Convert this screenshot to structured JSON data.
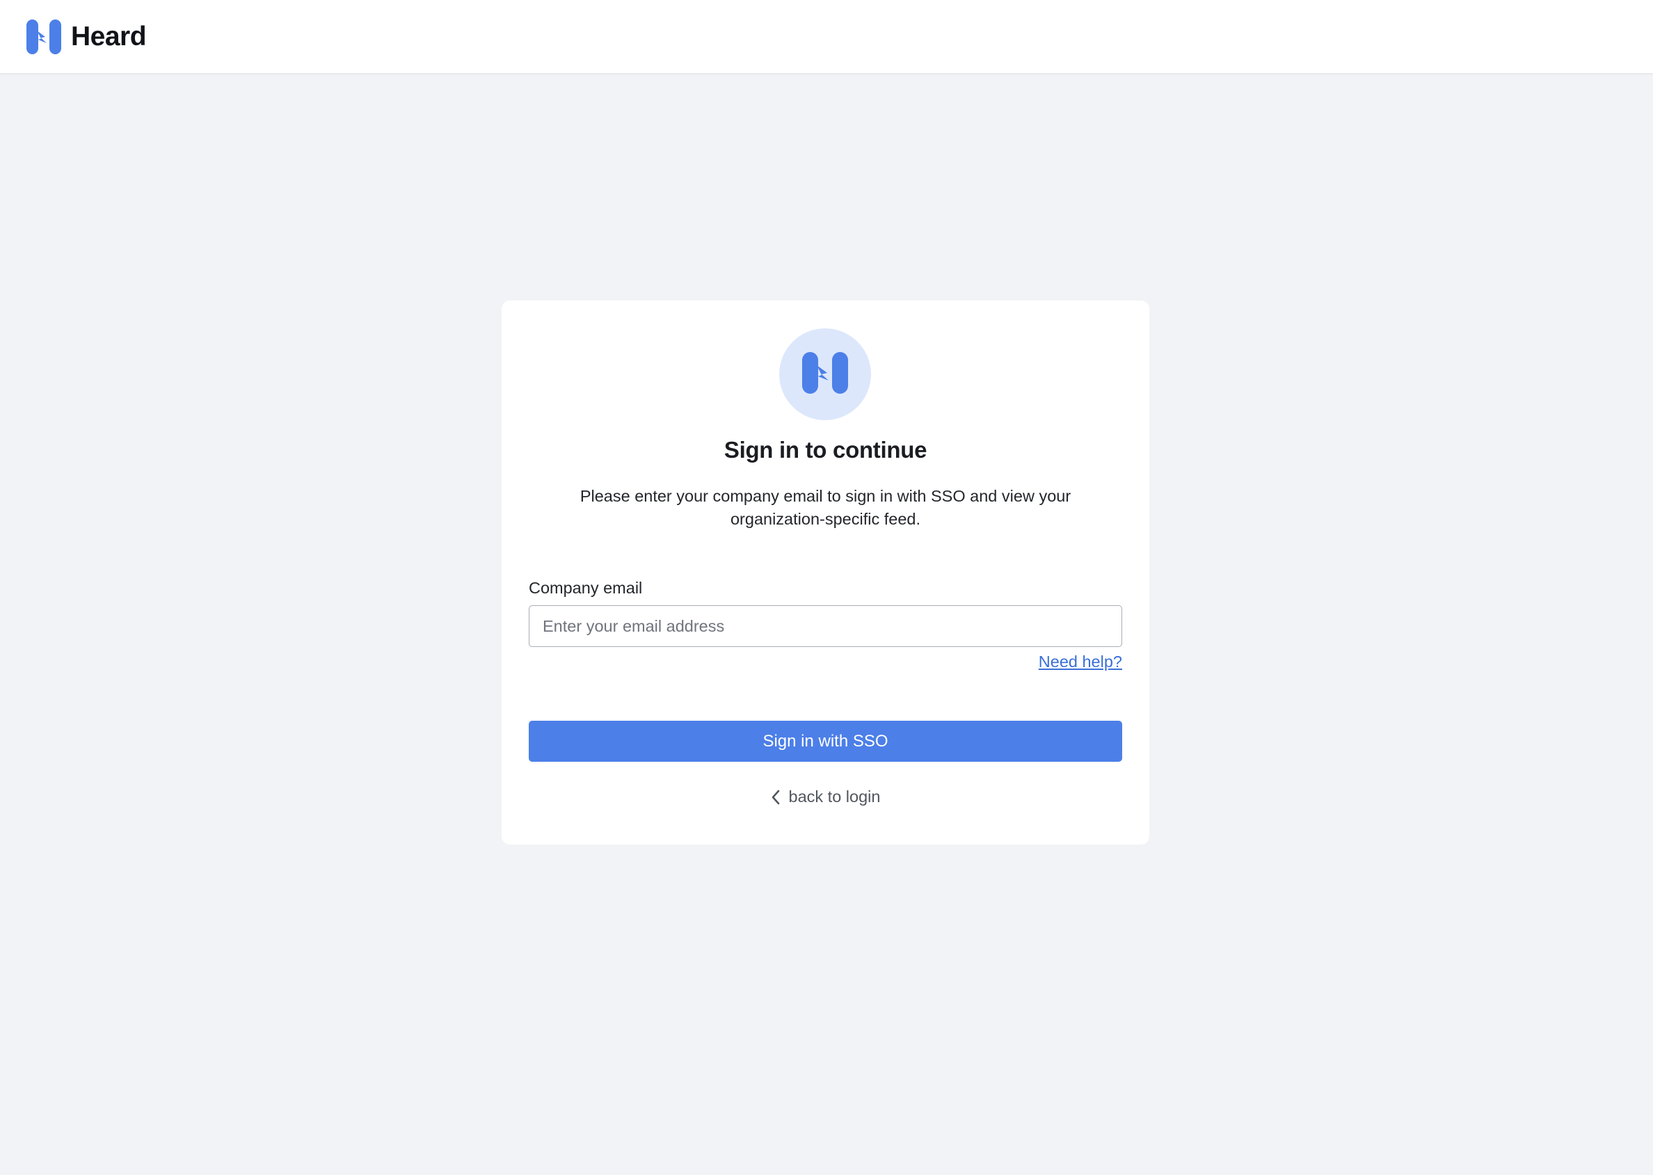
{
  "header": {
    "brand_name": "Heard"
  },
  "colors": {
    "accent": "#4c7fe8",
    "logo_bg": "#dde7fc",
    "page_bg": "#f2f3f7",
    "link": "#3a6fd8"
  },
  "icons": {
    "brand": "heard-logo-icon",
    "card_logo": "heard-logo-icon",
    "back": "chevron-left-icon"
  },
  "signin": {
    "title": "Sign in to continue",
    "description": "Please enter your company email to sign in with SSO and view your organization-specific feed.",
    "email_label": "Company email",
    "email_value": "",
    "email_placeholder": "Enter your email address",
    "help_link": "Need help?",
    "submit_label": "Sign in with SSO",
    "back_label": "back to login"
  }
}
